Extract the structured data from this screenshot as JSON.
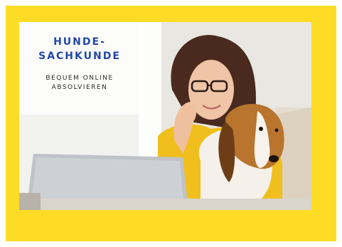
{
  "headline": {
    "line1": "HUNDE-",
    "line2": "SACHKUNDE"
  },
  "subline": {
    "line1": "BEQUEM ONLINE",
    "line2": "ABSOLVIEREN"
  },
  "colors": {
    "frame": "#fedc26",
    "headline": "#2248a8",
    "subline": "#2a2a2a"
  },
  "image": {
    "content": "woman with glasses hugging a beagle in front of a laptop"
  }
}
